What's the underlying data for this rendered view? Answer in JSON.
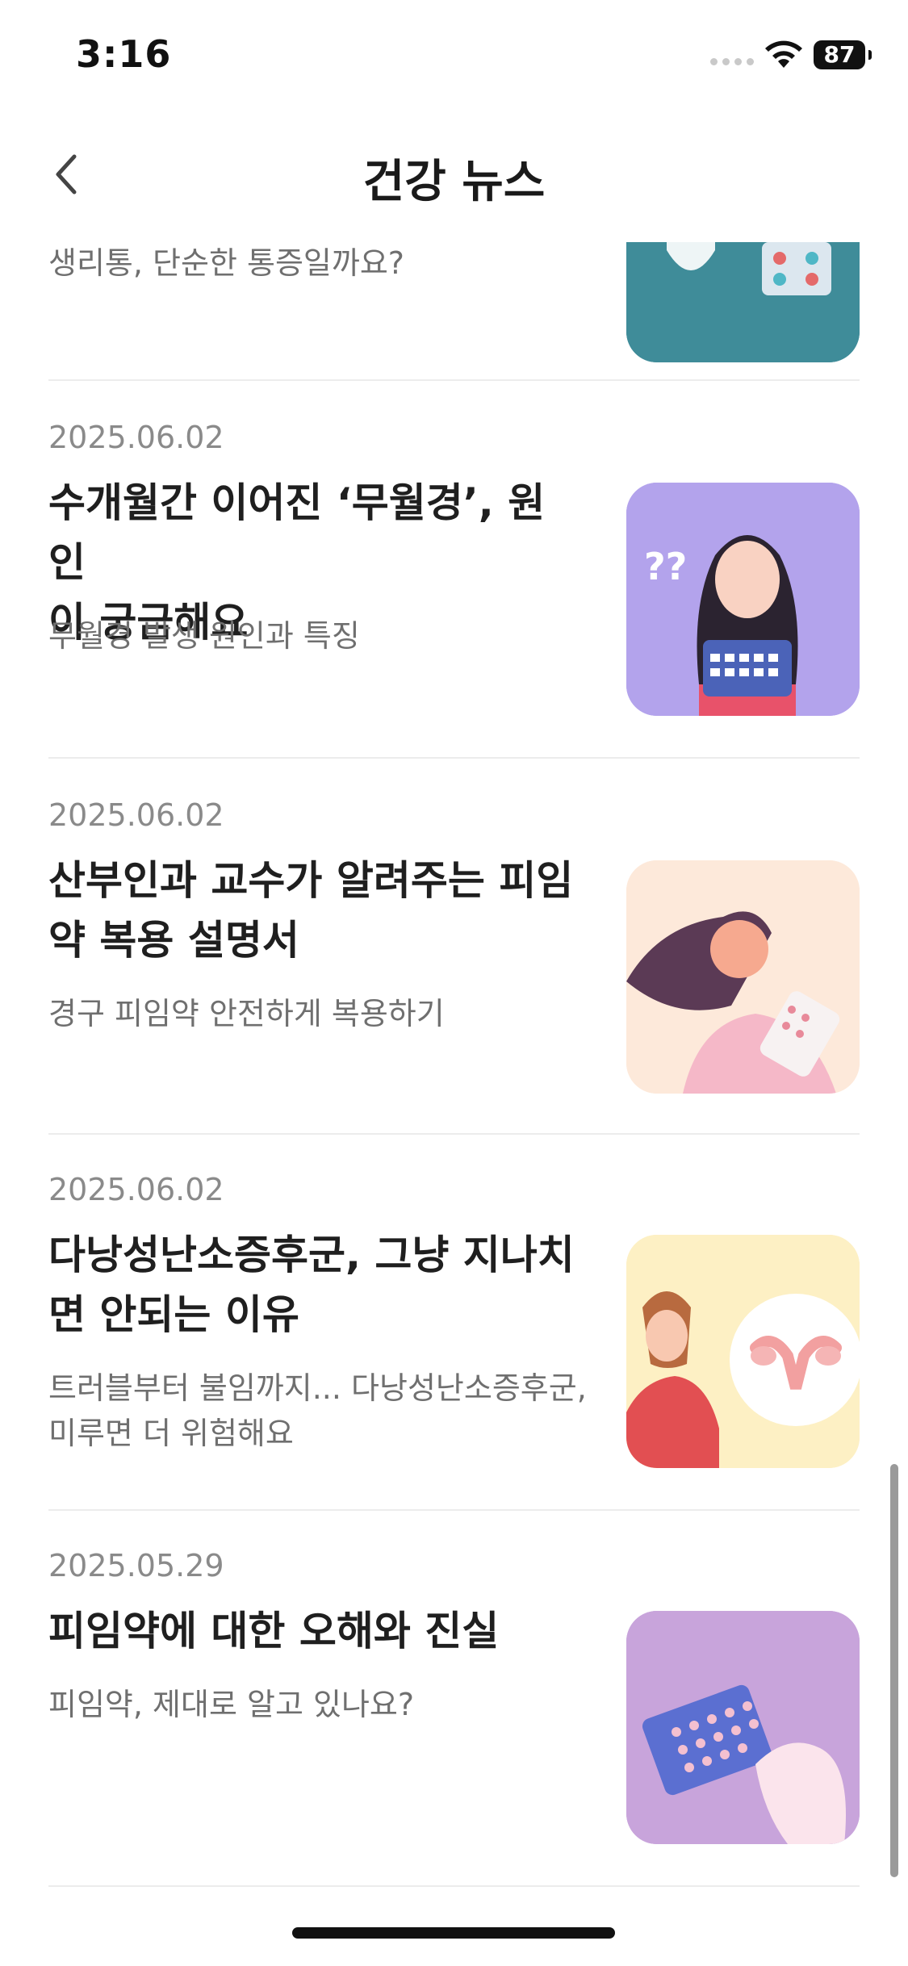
{
  "status": {
    "time": "3:16",
    "battery": "87"
  },
  "header": {
    "title": "건강 뉴스"
  },
  "articles": [
    {
      "summary": "생리통, 단순한 통증일까요?"
    },
    {
      "date": "2025.06.02",
      "title_line1": "수개월간 이어진 ‘무월경’, 원인",
      "title_line2": "이 궁금해요",
      "summary": "무월경 발생 원인과 특징"
    },
    {
      "date": "2025.06.02",
      "title_line1": "산부인과 교수가 알려주는 피임",
      "title_line2": "약 복용 설명서",
      "summary": "경구 피임약 안전하게 복용하기"
    },
    {
      "date": "2025.06.02",
      "title_line1": "다낭성난소증후군, 그냥 지나치",
      "title_line2": "면 안되는 이유",
      "summary_line1": "트러블부터 불임까지... 다낭성난소증후군,",
      "summary_line2": "미루면 더 위험해요"
    },
    {
      "date": "2025.05.29",
      "title_line1": "피임약에 대한 오해와 진실",
      "summary": "피임약, 제대로 알고 있나요?"
    }
  ],
  "colors": {
    "thumb_teal": "#3f8c99",
    "thumb_purple": "#b3a3ec",
    "thumb_peach": "#fde9da",
    "thumb_yellow": "#fdf0c4",
    "thumb_lilac": "#c8a4db"
  }
}
